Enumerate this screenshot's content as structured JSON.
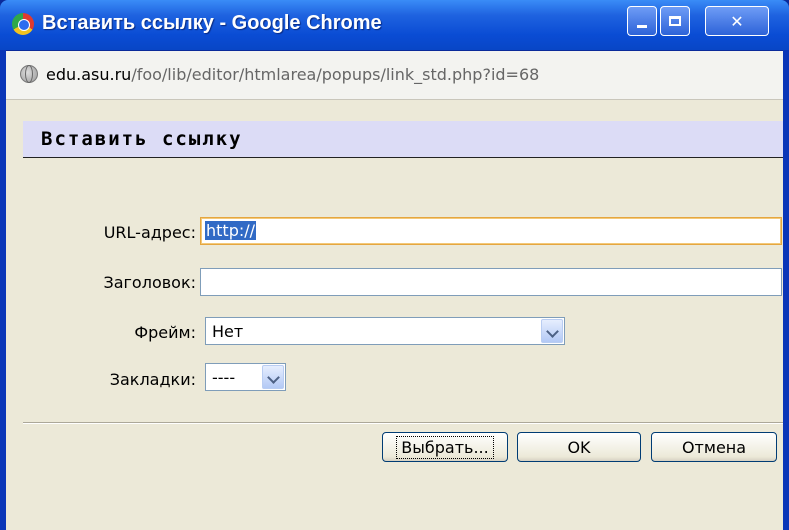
{
  "window": {
    "title": "Вставить ссылку - Google Chrome",
    "controls": {
      "minimize": "minimize",
      "maximize": "maximize",
      "close": "✕"
    }
  },
  "address": {
    "host": "edu.asu.ru",
    "path": "/foo/lib/editor/htmlarea/popups/link_std.php?id=68"
  },
  "dialog": {
    "title": "Вставить ссылку",
    "fields": {
      "url": {
        "label": "URL-адрес:",
        "value": "http://"
      },
      "heading": {
        "label": "Заголовок:",
        "value": ""
      },
      "frame": {
        "label": "Фрейм:",
        "value": "Нет"
      },
      "bookmarks": {
        "label": "Закладки:",
        "value": "----"
      }
    },
    "buttons": {
      "browse": "Выбрать...",
      "ok": "OK",
      "cancel": "Отмена"
    }
  },
  "colors": {
    "titlebar": "#0a4cd4",
    "dialog_bg": "#ece9d8",
    "header_band": "#dcdcf6",
    "selection": "#316ac5"
  }
}
